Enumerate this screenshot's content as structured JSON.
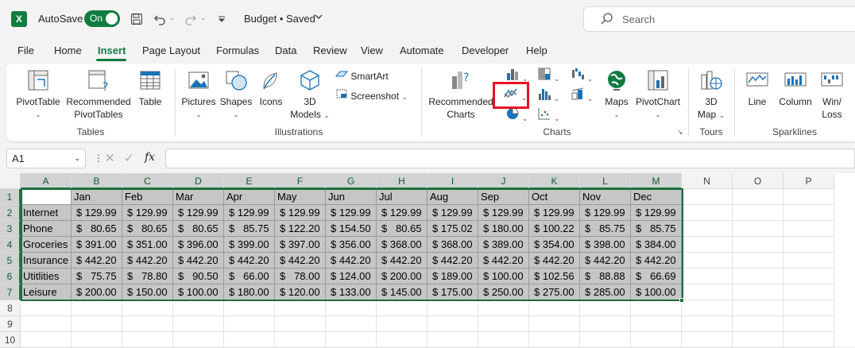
{
  "titlebar": {
    "app_icon": "X",
    "autosave_label": "AutoSave",
    "autosave_state": "On",
    "doc_title": "Budget • Saved",
    "search_placeholder": "Search"
  },
  "menu": {
    "tabs": [
      "File",
      "Home",
      "Insert",
      "Page Layout",
      "Formulas",
      "Data",
      "Review",
      "View",
      "Automate",
      "Developer",
      "Help"
    ],
    "active": "Insert"
  },
  "ribbon": {
    "pivottable": "PivotTable",
    "recommended_pivottables": [
      "Recommended",
      "PivotTables"
    ],
    "table": "Table",
    "group_tables": "Tables",
    "pictures": "Pictures",
    "shapes": "Shapes",
    "icons": "Icons",
    "models": [
      "3D",
      "Models"
    ],
    "smartart": "SmartArt",
    "screenshot": "Screenshot",
    "group_illustrations": "Illustrations",
    "recommended_charts": [
      "Recommended",
      "Charts"
    ],
    "maps": "Maps",
    "pivotchart": "PivotChart",
    "group_charts": "Charts",
    "map3d": [
      "3D",
      "Map"
    ],
    "group_tours": "Tours",
    "line": "Line",
    "column": "Column",
    "winloss": [
      "Win/",
      "Loss"
    ],
    "group_sparklines": "Sparklines"
  },
  "formula_bar": {
    "name_box": "A1",
    "fx": "fx",
    "formula": ""
  },
  "sheet": {
    "columns": [
      "A",
      "B",
      "C",
      "D",
      "E",
      "F",
      "G",
      "H",
      "I",
      "J",
      "K",
      "L",
      "M",
      "N",
      "O",
      "P"
    ],
    "rows": [
      "1",
      "2",
      "3",
      "4",
      "5",
      "6",
      "7",
      "8",
      "9",
      "10"
    ],
    "header_row": [
      "",
      "Jan",
      "Feb",
      "Mar",
      "Apr",
      "May",
      "Jun",
      "Jul",
      "Aug",
      "Sep",
      "Oct",
      "Nov",
      "Dec"
    ],
    "data": [
      [
        "Internet",
        "$ 129.99",
        "$ 129.99",
        "$ 129.99",
        "$ 129.99",
        "$ 129.99",
        "$ 129.99",
        "$ 129.99",
        "$ 129.99",
        "$ 129.99",
        "$ 129.99",
        "$ 129.99",
        "$ 129.99"
      ],
      [
        "Phone",
        "$   80.65",
        "$   80.65",
        "$   80.65",
        "$   85.75",
        "$ 122.20",
        "$ 154.50",
        "$   80.65",
        "$ 175.02",
        "$ 180.00",
        "$ 100.22",
        "$   85.75",
        "$   85.75"
      ],
      [
        "Groceries",
        "$ 391.00",
        "$ 351.00",
        "$ 396.00",
        "$ 399.00",
        "$ 397.00",
        "$ 356.00",
        "$ 368.00",
        "$ 368.00",
        "$ 389.00",
        "$ 354.00",
        "$ 398.00",
        "$ 384.00"
      ],
      [
        "Insurance",
        "$ 442.20",
        "$ 442.20",
        "$ 442.20",
        "$ 442.20",
        "$ 442.20",
        "$ 442.20",
        "$ 442.20",
        "$ 442.20",
        "$ 442.20",
        "$ 442.20",
        "$ 442.20",
        "$ 442.20"
      ],
      [
        "Utitlities",
        "$   75.75",
        "$   78.80",
        "$   90.50",
        "$   66.00",
        "$   78.00",
        "$ 124.00",
        "$ 200.00",
        "$ 189.00",
        "$ 100.00",
        "$ 102.56",
        "$   88.88",
        "$   66.69"
      ],
      [
        "Leisure",
        "$ 200.00",
        "$ 150.00",
        "$ 100.00",
        "$ 180.00",
        "$ 120.00",
        "$ 133.00",
        "$ 145.00",
        "$ 175.00",
        "$ 250.00",
        "$ 275.00",
        "$ 285.00",
        "$ 100.00"
      ]
    ]
  },
  "colors": {
    "accent": "#107c41",
    "highlight": "#e81123"
  }
}
